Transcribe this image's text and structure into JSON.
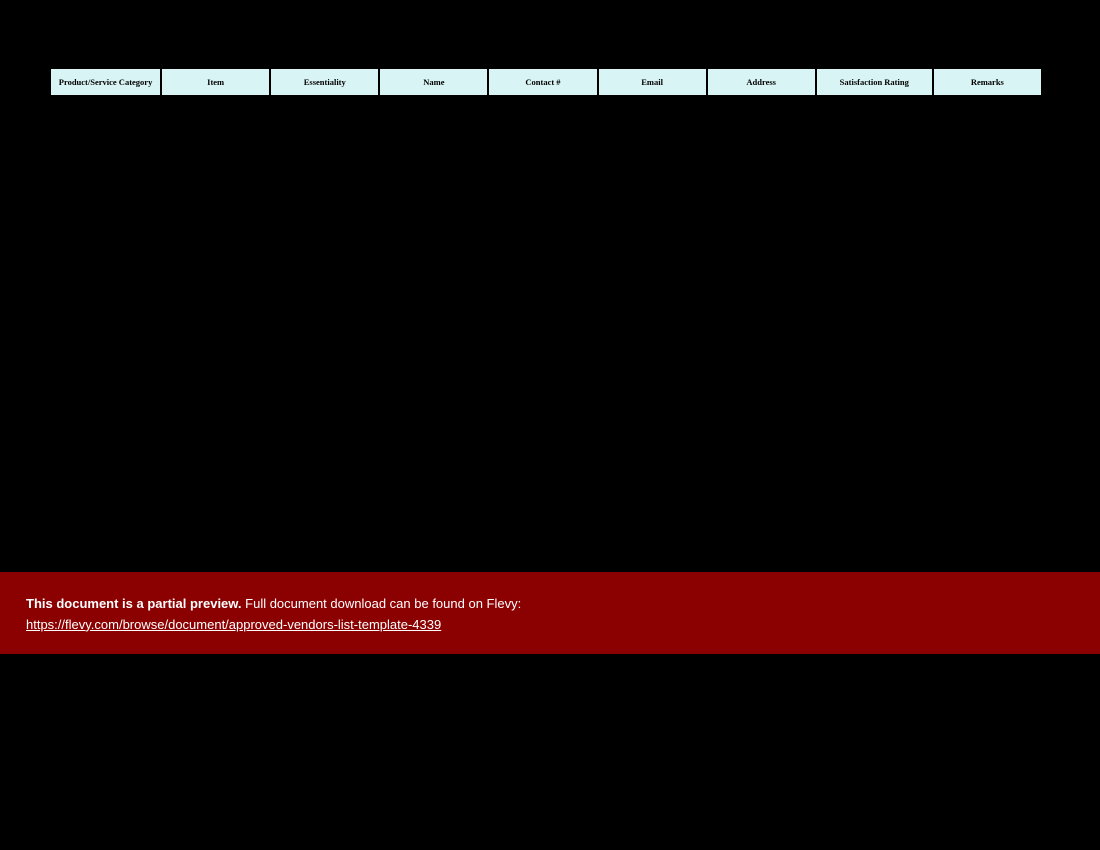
{
  "table": {
    "headers": [
      "Product/Service Category",
      "Item",
      "Essentiality",
      "Name",
      "Contact #",
      "Email",
      "Address",
      "Satisfaction Rating",
      "Remarks"
    ]
  },
  "notice": {
    "bold_text": "This document is a partial preview.",
    "rest_text": "  Full document download can be found on Flevy:",
    "link_text": "https://flevy.com/browse/document/approved-vendors-list-template-4339",
    "link_href": "https://flevy.com/browse/document/approved-vendors-list-template-4339"
  }
}
